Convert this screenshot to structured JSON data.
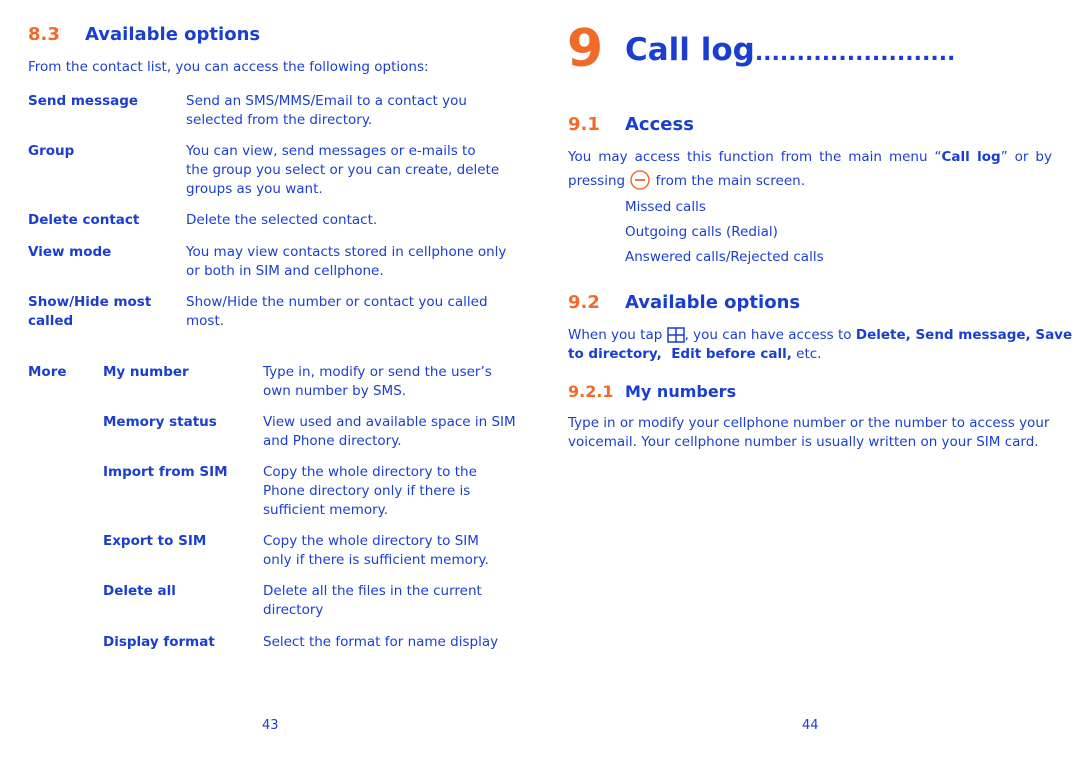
{
  "colors": {
    "text": "#1a3fd0",
    "accent": "#f26a2a"
  },
  "left": {
    "section_number": "8.3",
    "section_title": "Available options",
    "intro": "From the contact list, you can access the following options:",
    "options": [
      {
        "label": [
          "Send message"
        ],
        "desc": [
          "Send an SMS/MMS/Email to a contact you",
          "selected from the directory."
        ]
      },
      {
        "label": [
          "Group"
        ],
        "desc": [
          "You can view, send messages or e-mails to",
          "the group you select or you can create, delete",
          "groups as you want."
        ]
      },
      {
        "label": [
          "Delete contact"
        ],
        "desc": [
          "Delete the selected contact."
        ]
      },
      {
        "label": [
          "View mode"
        ],
        "desc": [
          "You may view contacts stored in cellphone only",
          "or both in SIM and cellphone."
        ]
      },
      {
        "label": [
          "Show/Hide most",
          "called"
        ],
        "desc": [
          "Show/Hide the number or contact you called",
          "most."
        ]
      }
    ],
    "more_label": "More",
    "more_options": [
      {
        "label": "My number",
        "desc": [
          "Type in, modify or send the user’s",
          "own number by SMS."
        ]
      },
      {
        "label": "Memory status",
        "desc": [
          "View used and available space in SIM",
          "and Phone directory."
        ]
      },
      {
        "label": "Import from SIM",
        "desc": [
          "Copy the whole directory to the",
          "Phone directory only if there is",
          "sufficient memory."
        ]
      },
      {
        "label": "Export to SIM",
        "desc": [
          "Copy the whole directory to SIM",
          "only if there is sufficient memory."
        ]
      },
      {
        "label": "Delete all",
        "desc": [
          "Delete all the files in the current",
          "directory"
        ]
      },
      {
        "label": "Display format",
        "desc": [
          "Select the format for name display"
        ]
      }
    ],
    "page_number": "43"
  },
  "right": {
    "chapter_number": "9",
    "chapter_title": "Call log",
    "chapter_leader": "........................",
    "access": {
      "number": "9.1",
      "title": "Access",
      "p1_a": "You may access this function from the main menu “",
      "p1_bold": "Call log",
      "p1_b": "” or by",
      "p2_a": "pressing",
      "p2_icon": "minus-circle-key-icon",
      "p2_b": " from the main screen.",
      "items": [
        "Missed calls",
        "Outgoing calls (Redial)",
        "Answered calls/Rejected calls"
      ]
    },
    "options": {
      "number": "9.2",
      "title": "Available options",
      "p1_a": "When you tap",
      "p1_icon": "grid-menu-icon",
      "p1_b": ", you can have access to ",
      "p1_bold": "Delete, Send message, Save",
      "p2_bold": "to directory,  Edit before call,",
      "p2_b": " etc."
    },
    "my_numbers": {
      "number": "9.2.1",
      "title": "My numbers",
      "lines": [
        "Type in or modify your cellphone number or the number to access your",
        "voicemail. Your cellphone number is usually written on your SIM card."
      ]
    },
    "page_number": "44"
  }
}
